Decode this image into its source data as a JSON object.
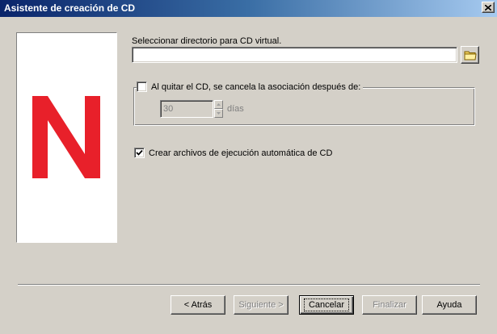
{
  "window": {
    "title": "Asistente de creación de CD"
  },
  "brand": {
    "logo_color": "#e8202a"
  },
  "directory": {
    "label": "Seleccionar directorio para CD virtual.",
    "value": ""
  },
  "unlink": {
    "label": "Al quitar el CD, se cancela la asociación después de:",
    "checked": false,
    "days_value": "30",
    "days_unit": "días"
  },
  "autorun": {
    "label": "Crear archivos de ejecución automática de CD",
    "checked": true
  },
  "buttons": {
    "back": "< Atrás",
    "next": "Siguiente >",
    "cancel": "Cancelar",
    "finish": "Finalizar",
    "help": "Ayuda"
  }
}
